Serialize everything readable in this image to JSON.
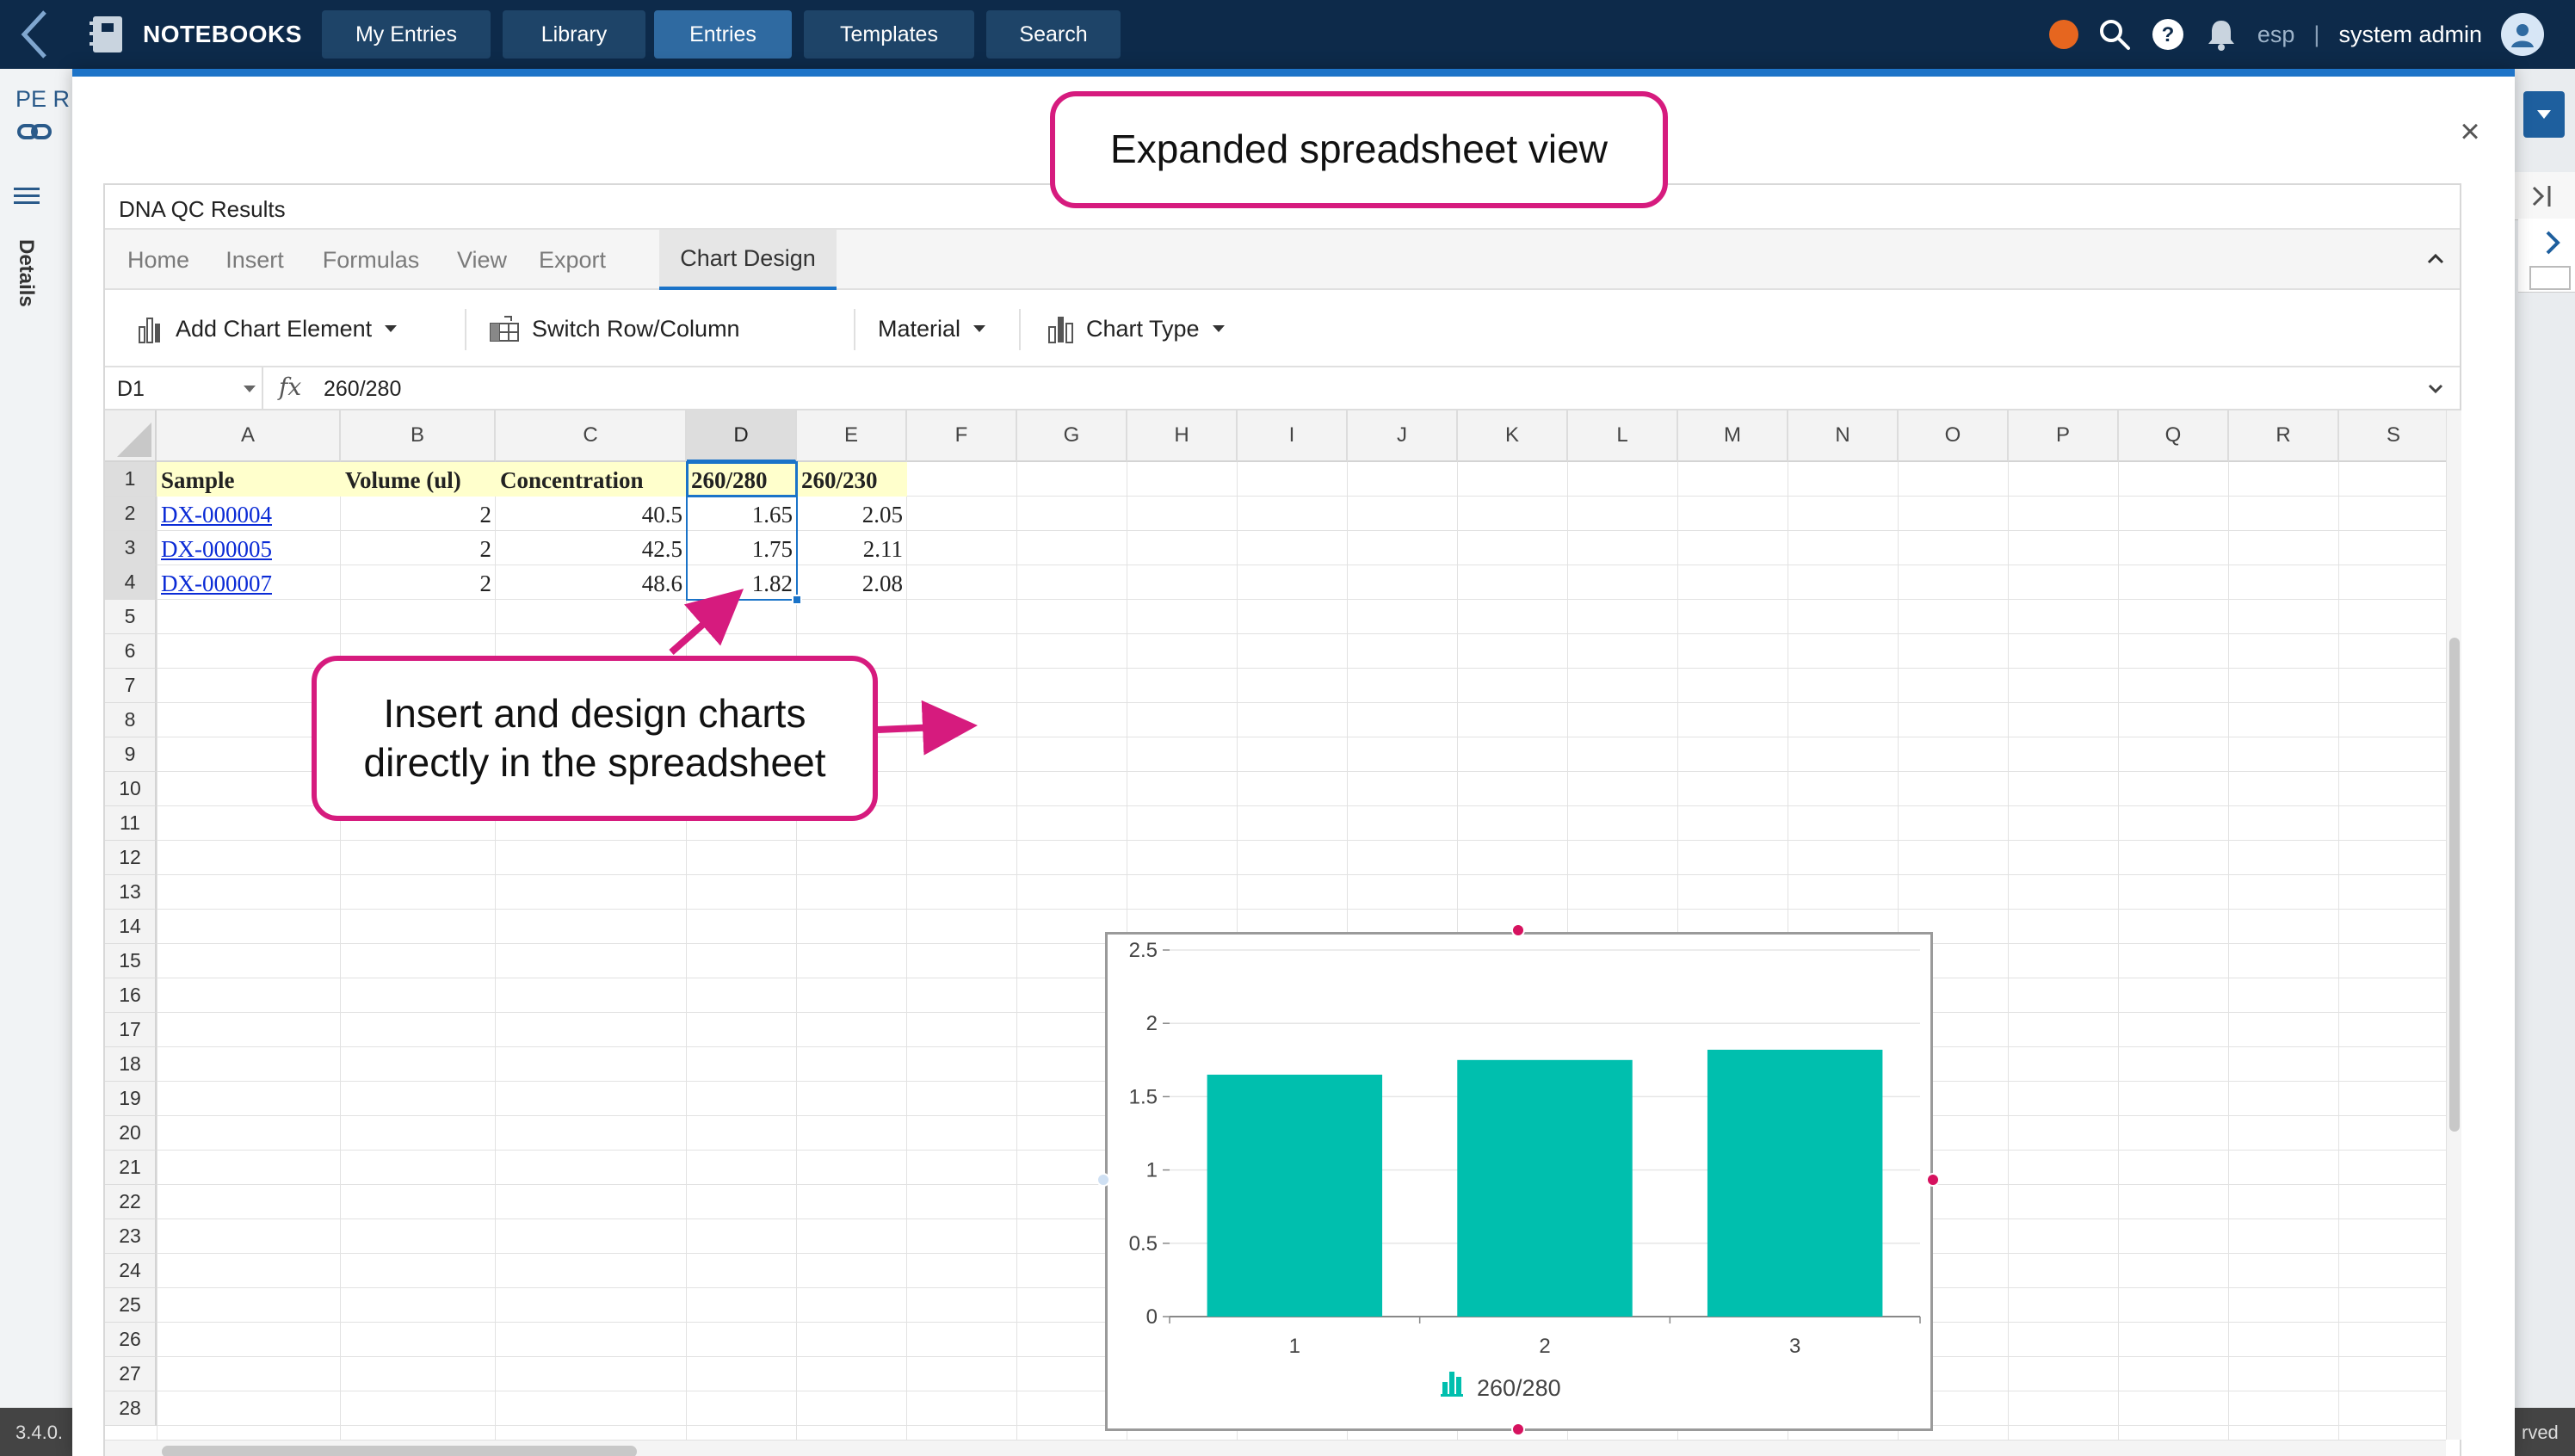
{
  "nav": {
    "brand": "NOTEBOOKS",
    "buttons": [
      {
        "label": "My Entries",
        "active": false
      },
      {
        "label": "Library",
        "active": false
      },
      {
        "label": "Entries",
        "active": true
      },
      {
        "label": "Templates",
        "active": false
      },
      {
        "label": "Search",
        "active": false
      }
    ],
    "lang": "esp",
    "separator": "|",
    "user": "system admin"
  },
  "background": {
    "left_title": "PE R",
    "details_tab": "Details",
    "version": "3.4.0.",
    "footer_right": "rved"
  },
  "spreadsheet": {
    "title": "DNA QC Results",
    "ribbon_tabs": [
      {
        "label": "Home",
        "active": false
      },
      {
        "label": "Insert",
        "active": false
      },
      {
        "label": "Formulas",
        "active": false
      },
      {
        "label": "View",
        "active": false
      },
      {
        "label": "Export",
        "active": false
      },
      {
        "label": "Chart Design",
        "active": true
      }
    ],
    "tools": {
      "add_chart_element": "Add Chart Element",
      "switch_row_column": "Switch Row/Column",
      "material": "Material",
      "chart_type": "Chart Type"
    },
    "name_box": "D1",
    "fx": "fx",
    "formula": "260/280",
    "columns": [
      "A",
      "B",
      "C",
      "D",
      "E",
      "F",
      "G",
      "H",
      "I",
      "J",
      "K",
      "L",
      "M",
      "N",
      "O",
      "P",
      "Q",
      "R",
      "S"
    ],
    "rows": [
      "1",
      "2",
      "3",
      "4",
      "5",
      "6",
      "7",
      "8",
      "9",
      "10",
      "11",
      "12",
      "13",
      "14",
      "15",
      "16",
      "17",
      "18",
      "19",
      "20",
      "21",
      "22",
      "23",
      "24",
      "25",
      "26",
      "27",
      "28"
    ],
    "header_row": [
      "Sample",
      "Volume (ul)",
      "Concentration",
      "260/280",
      "260/230"
    ],
    "data_rows": [
      [
        "DX-000004",
        "2",
        "40.5",
        "1.65",
        "2.05"
      ],
      [
        "DX-000005",
        "2",
        "42.5",
        "1.75",
        "2.11"
      ],
      [
        "DX-000007",
        "2",
        "48.6",
        "1.82",
        "2.08"
      ]
    ]
  },
  "chart_data": {
    "type": "bar",
    "categories": [
      "1",
      "2",
      "3"
    ],
    "series": [
      {
        "name": "260/280",
        "values": [
          1.65,
          1.75,
          1.82
        ]
      }
    ],
    "title": "",
    "xlabel": "",
    "ylabel": "",
    "ylim": [
      0,
      2.5
    ],
    "yticks": [
      "0",
      "0.5",
      "1",
      "1.5",
      "2",
      "2.5"
    ],
    "grid": true,
    "legend": "bottom",
    "color": "#00bfae"
  },
  "callouts": {
    "expanded": "Expanded spreadsheet view",
    "insert_line1": "Insert and design charts",
    "insert_line2": "directly in the spreadsheet"
  },
  "colors": {
    "nav_bg": "#0d2a4a",
    "accent": "#1a73c8",
    "callout_border": "#d61b7e",
    "bar": "#00bfae"
  }
}
